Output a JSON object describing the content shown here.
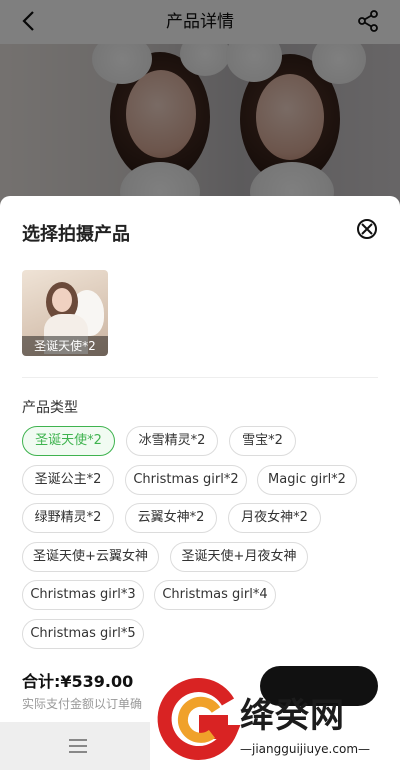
{
  "header": {
    "title": "产品详情"
  },
  "sheet": {
    "title": "选择拍摄产品",
    "selected_thumb_label": "圣诞天使*2",
    "section_label": "产品类型",
    "chips": [
      "圣诞天使*2",
      "冰雪精灵*2",
      "雪宝*2",
      "圣诞公主*2",
      "Christmas girl*2",
      "Magic girl*2",
      "绿野精灵*2",
      "云翼女神*2",
      "月夜女神*2",
      "圣诞天使+云翼女神",
      "圣诞天使+月夜女神",
      "Christmas girl*3",
      "Christmas girl*4",
      "Christmas girl*5"
    ],
    "active_chip": "圣诞天使*2",
    "total_label": "合计:¥539.00",
    "total_note": "实际支付金额以订单确"
  },
  "watermark": {
    "name": "绛癸网",
    "url": "—jiangguijiuye.com—"
  },
  "icons": {
    "back": "chevron-left-icon",
    "share": "share-icon",
    "close": "close-circle-icon",
    "menu": "menu-icon"
  },
  "colors": {
    "accent": "#3fb34f",
    "overlay": "rgba(0,0,0,0.5)"
  }
}
